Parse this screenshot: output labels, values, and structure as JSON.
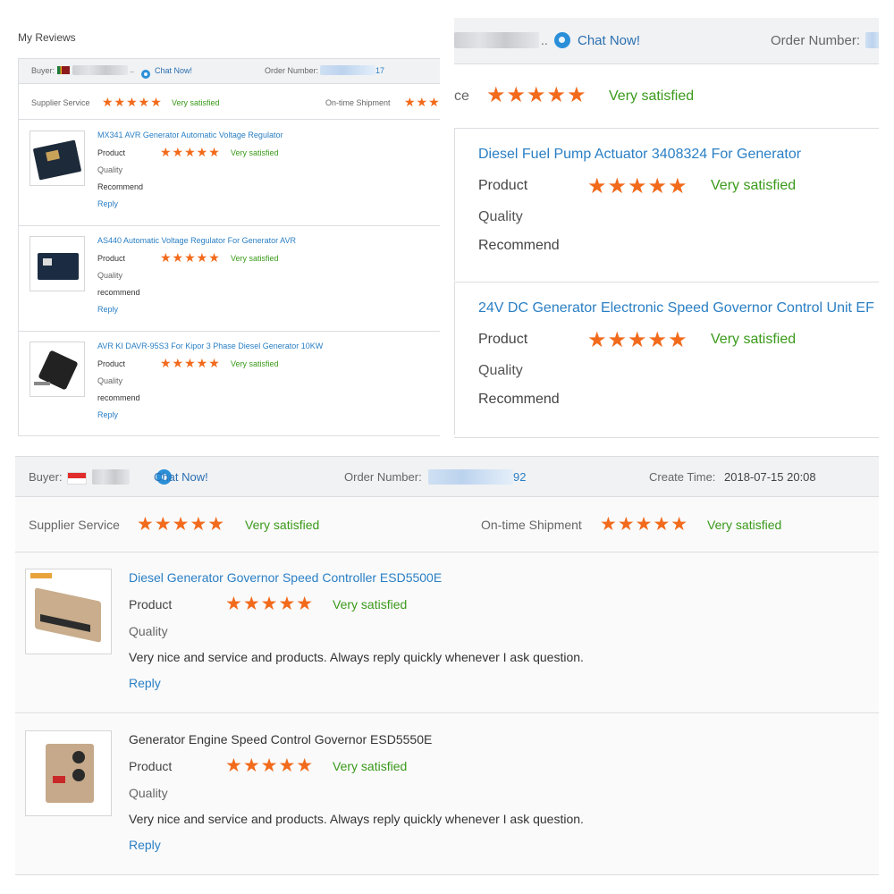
{
  "colors": {
    "star": "#f26a1b",
    "satisfied": "#3a9a1a",
    "link": "#2a7fc4",
    "bar": "#f1f2f4"
  },
  "panel1": {
    "title": "My Reviews",
    "buyer_label": "Buyer:",
    "buyer_ellipsis": "..",
    "chat_label": "Chat Now!",
    "order_label": "Order Number:",
    "order_suffix": "17",
    "supplier_service_label": "Supplier Service",
    "supplier_rating": "★★★★★",
    "supplier_rating_text": "Very satisfied",
    "shipment_label": "On-time Shipment",
    "shipment_rating": "★★★",
    "items": [
      {
        "title": "MX341 AVR Generator Automatic Voltage Regulator",
        "product_label": "Product",
        "rating": "★★★★★",
        "rating_text": "Very satisfied",
        "quality_label": "Quality",
        "recommend_label": "Recommend",
        "reply_label": "Reply"
      },
      {
        "title": "AS440 Automatic Voltage Regulator For Generator AVR",
        "product_label": "Product",
        "rating": "★★★★★",
        "rating_text": "Very satisfied",
        "quality_label": "Quality",
        "recommend_label": "recommend",
        "reply_label": "Reply"
      },
      {
        "title": "AVR KI DAVR-95S3 For Kipor 3 Phase Diesel Generator 10KW",
        "product_label": "Product",
        "rating": "★★★★★",
        "rating_text": "Very satisfied",
        "quality_label": "Quality",
        "recommend_label": "recommend",
        "reply_label": "Reply"
      }
    ]
  },
  "panel2": {
    "buyer_ellipsis": "..",
    "chat_label": "Chat Now!",
    "order_label": "Order Number:",
    "service_fragment": "ce",
    "service_rating": "★★★★★",
    "service_rating_text": "Very satisfied",
    "items": [
      {
        "title": "Diesel Fuel Pump Actuator 3408324 For Generator",
        "product_label": "Product",
        "rating": "★★★★★",
        "rating_text": "Very satisfied",
        "quality_label": "Quality",
        "recommend_label": "Recommend"
      },
      {
        "title": "24V DC Generator Electronic Speed Governor Control Unit EF",
        "product_label": "Product",
        "rating": "★★★★★",
        "rating_text": "Very satisfied",
        "quality_label": "Quality",
        "recommend_label": "Recommend"
      }
    ]
  },
  "panel3": {
    "buyer_label": "Buyer:",
    "chat_label": "Chat Now!",
    "order_label": "Order Number:",
    "order_suffix": "92",
    "create_time_label": "Create Time:",
    "create_time_value": "2018-07-15 20:08",
    "supplier_service_label": "Supplier Service",
    "supplier_rating": "★★★★★",
    "supplier_rating_text": "Very satisfied",
    "shipment_label": "On-time Shipment",
    "shipment_rating": "★★★★★",
    "shipment_rating_text": "Very satisfied",
    "items": [
      {
        "title": "Diesel Generator Governor Speed Controller ESD5500E",
        "product_label": "Product",
        "rating": "★★★★★",
        "rating_text": "Very satisfied",
        "quality_label": "Quality",
        "comment": "Very nice and service and products. Always reply quickly whenever I ask question.",
        "reply_label": "Reply"
      },
      {
        "title": "Generator Engine Speed Control Governor ESD5550E",
        "product_label": "Product",
        "rating": "★★★★★",
        "rating_text": "Very satisfied",
        "quality_label": "Quality",
        "comment": "Very nice and service and products. Always reply quickly whenever I ask question.",
        "reply_label": "Reply"
      }
    ]
  }
}
